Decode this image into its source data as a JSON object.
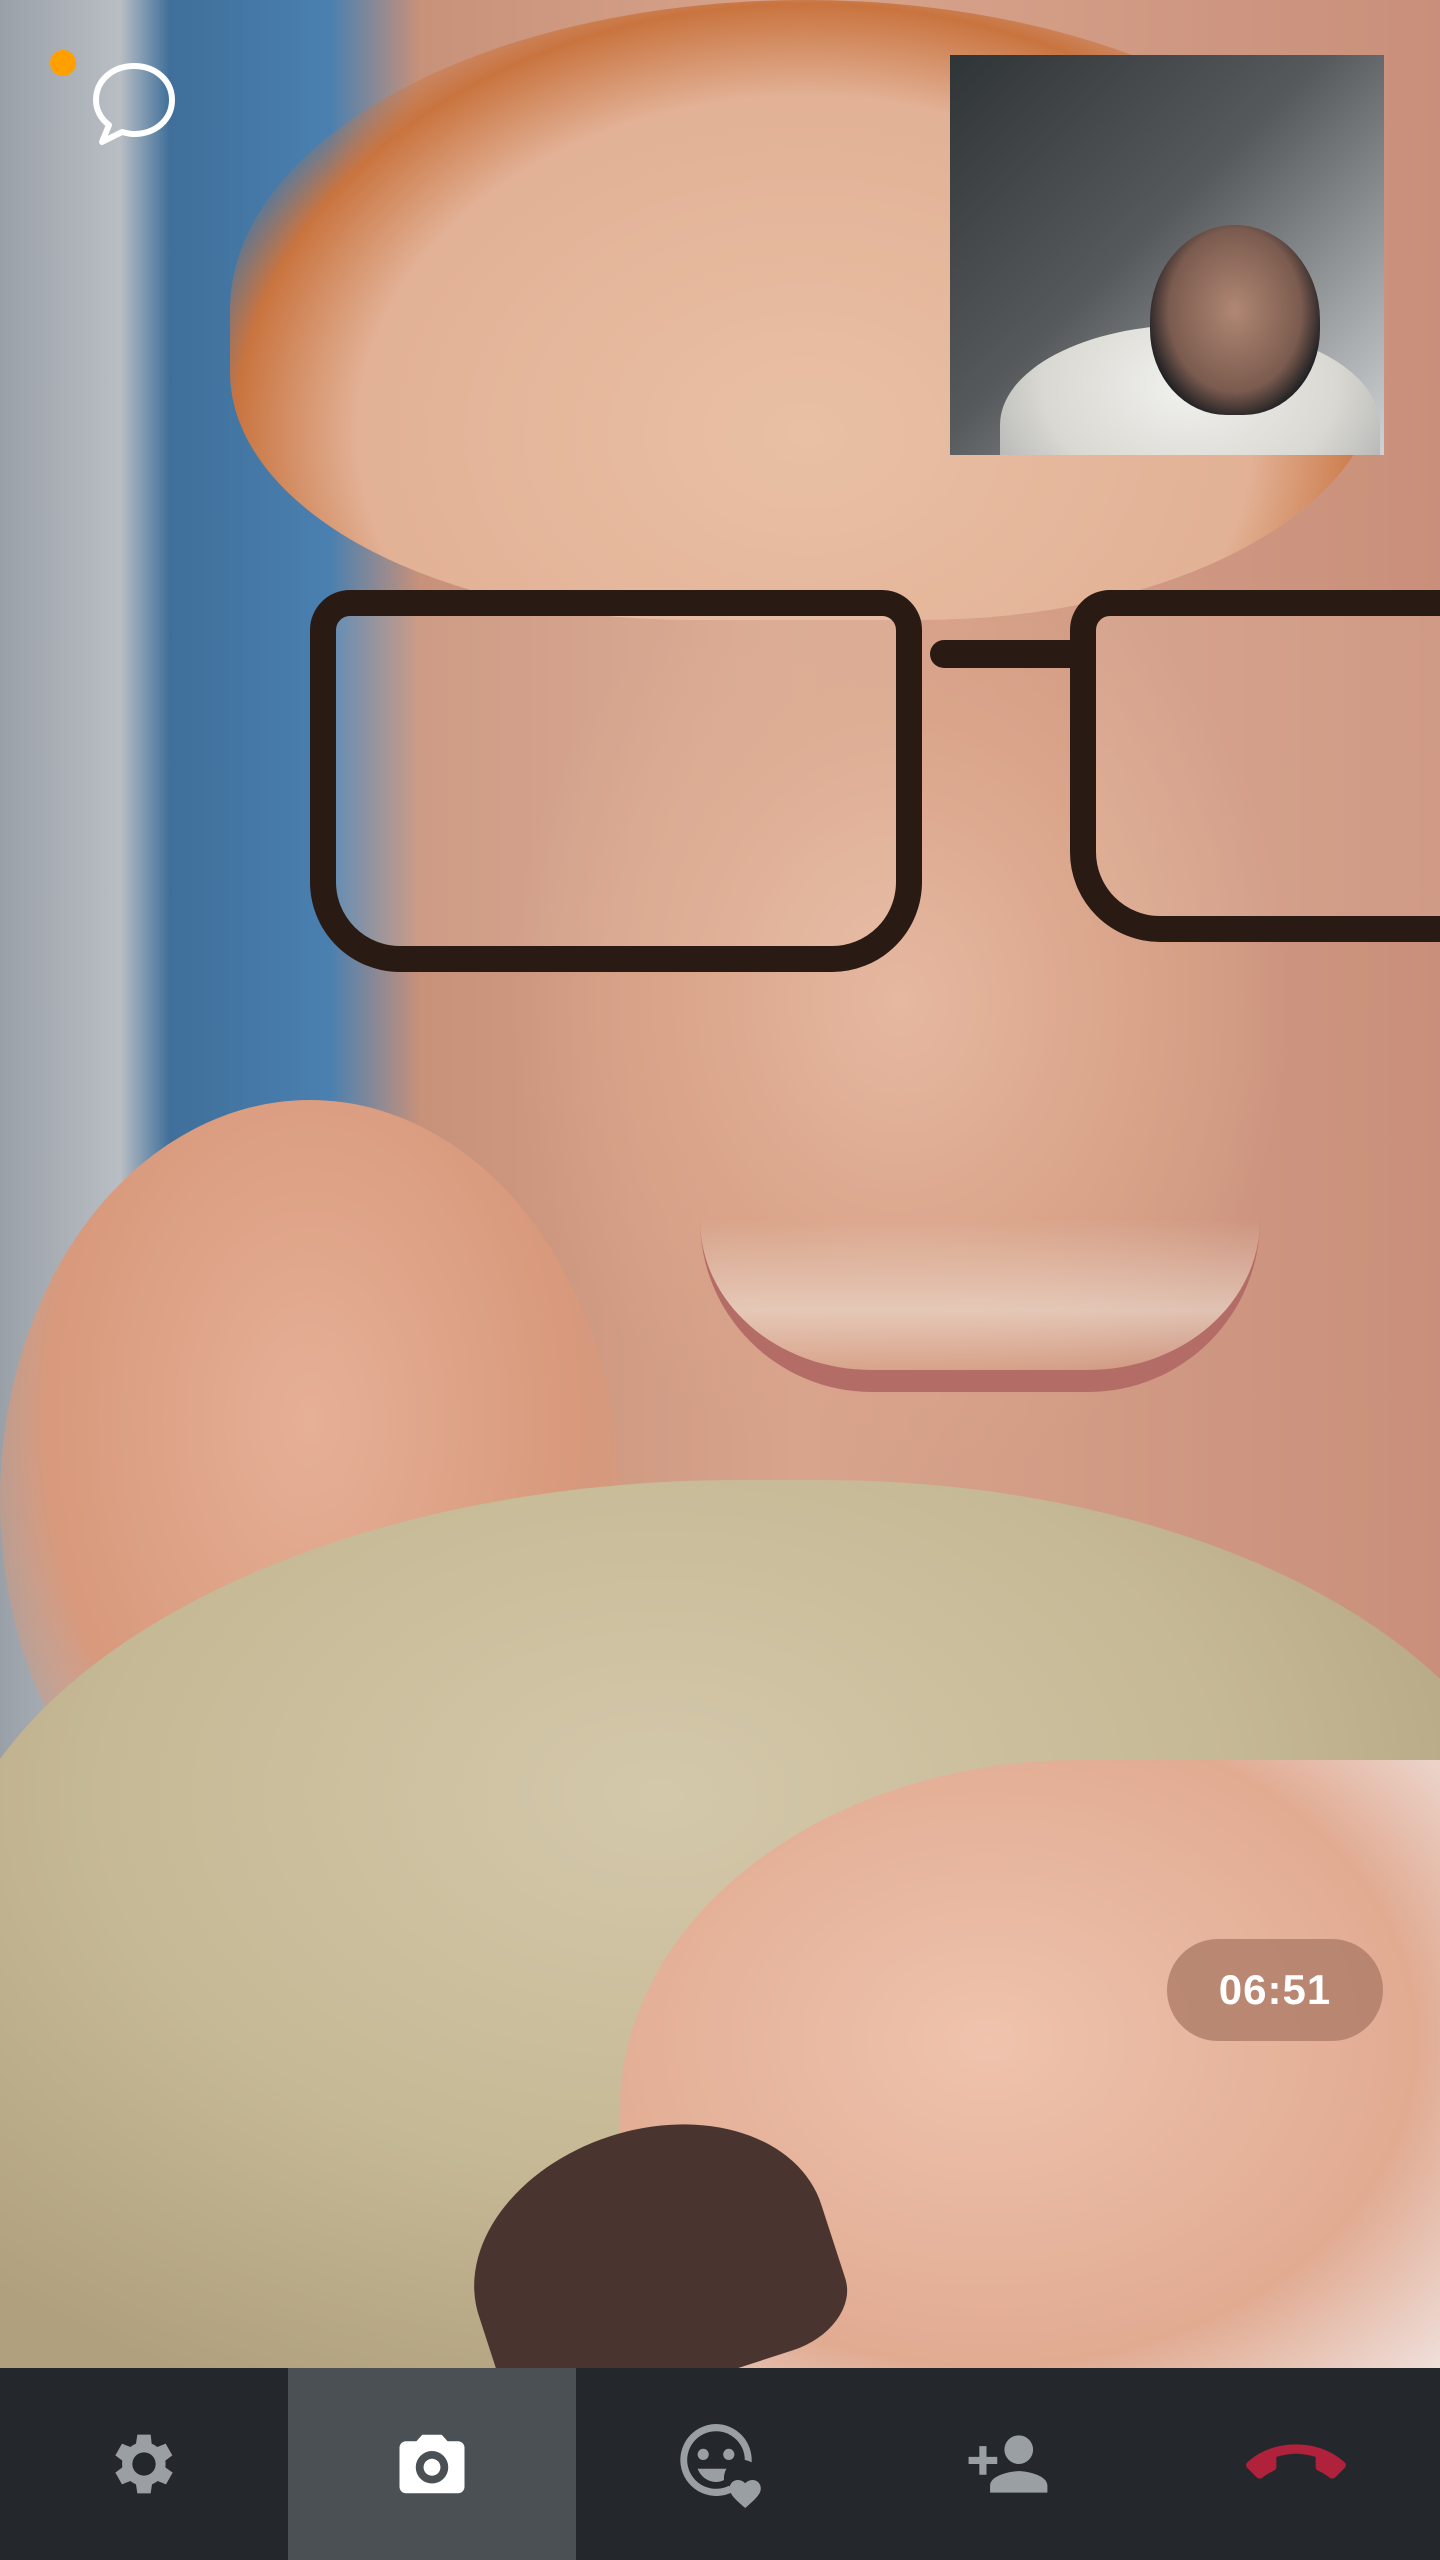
{
  "call": {
    "timer": "06:51",
    "has_notification": true
  },
  "icons": {
    "chat": "chat-bubble-icon",
    "settings": "gear-icon",
    "camera": "camera-icon",
    "reactions": "emoji-heart-icon",
    "add_person": "add-person-icon",
    "end_call": "phone-hangup-icon"
  },
  "colors": {
    "notification_dot": "#ffa000",
    "toolbar_bg": "#24282c",
    "toolbar_active_bg": "#4b5055",
    "icon_gray": "#9a9fa4",
    "end_call_red": "#b0213c",
    "timer_bg": "rgba(170,120,100,0.75)"
  },
  "toolbar": {
    "active_index": 1
  }
}
